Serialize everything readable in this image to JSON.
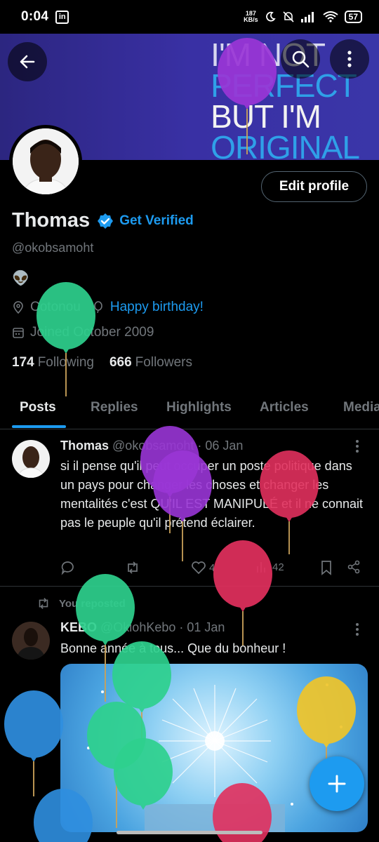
{
  "status_bar": {
    "time": "0:04",
    "app_badge": "in",
    "net_speed_value": "187",
    "net_speed_unit": "KB/s",
    "battery": "57"
  },
  "banner": {
    "lines": [
      "I'M NOT",
      "PERFECT",
      "BUT I'M",
      "ORIGINAL"
    ],
    "colors": {
      "top": "#2c2680",
      "accent": "#2fa0e8"
    }
  },
  "profile": {
    "name": "Thomas",
    "get_verified": "Get Verified",
    "handle": "@okobsamoht",
    "emoji": "👽",
    "location": "Cotonou",
    "birthday": "Happy birthday!",
    "joined": "Joined October 2009",
    "following_count": "174",
    "following_label": "Following",
    "followers_count": "666",
    "followers_label": "Followers",
    "edit_profile": "Edit profile"
  },
  "tabs": [
    "Posts",
    "Replies",
    "Highlights",
    "Articles",
    "Media"
  ],
  "posts": [
    {
      "name": "Thomas",
      "handle": "@okobsamoht",
      "date": "· 06 Jan",
      "text": "si il pense qu'il peut occuper un poste politique dans un pays pour changer les choses et changer les mentalités c'est QU'IL EST MANIPULÉ et il ne connait pas le peuple qu'il prétend éclairer.",
      "likes": "4",
      "views": "42"
    },
    {
      "reposted_label": "You reposted",
      "name": "KEBO",
      "handle": "@OkiohKebo",
      "date": "· 01 Jan",
      "text": "Bonne année à tous... Que du bonheur !"
    }
  ],
  "colors": {
    "accent": "#1d9bf0",
    "background": "#000000",
    "muted": "#71767b"
  }
}
